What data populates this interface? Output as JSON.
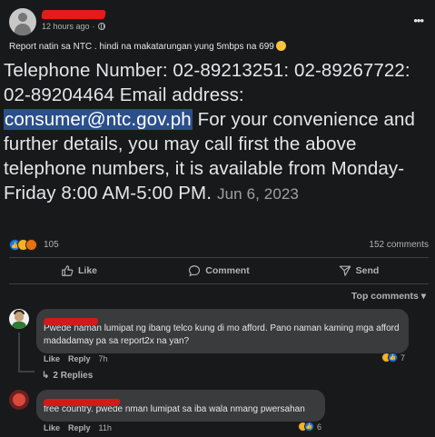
{
  "post": {
    "time": "12 hours ago",
    "dot": "·",
    "caption": "Report natin sa NTC . hindi na makatarungan yung 5mbps na 699",
    "menu_glyph": "•••"
  },
  "shared": {
    "line1": "Telephone Number: 02-89213251: 02-89267722:",
    "line2": "02-89204464 Email address:",
    "email": "consumer@ntc.gov.ph",
    "rest": " For your convenience and further details, you may call first the above telephone numbers, it is available from Monday-Friday 8:00 AM-5:00 PM.",
    "date": "Jun 6, 2023"
  },
  "stats": {
    "reactions": "105",
    "comments": "152 comments"
  },
  "actions": {
    "like": "Like",
    "comment": "Comment",
    "send": "Send"
  },
  "sort": {
    "label": "Top comments ▾"
  },
  "comments": [
    {
      "text": "Pwede naman lumipat ng ibang telco kung di mo afford. Pano naman kaming mga afford madadamay pa sa report2x na yan?",
      "like": "Like",
      "reply": "Reply",
      "time": "7h",
      "reaction_count": "7"
    },
    {
      "text": "free country. pwede nman lumipat sa iba wala nmang pwersahan",
      "like": "Like",
      "reply": "Reply",
      "time": "11h",
      "reaction_count": "6"
    }
  ],
  "replies": {
    "label": "2 Replies",
    "icon": "↳"
  },
  "colors": {
    "background": "#18191a",
    "bubble": "#3a3b3c",
    "email_highlight": "#2b4f8c",
    "like_blue": "#1877f2",
    "redaction": "#e21b1b"
  },
  "icons": [
    "globe-icon",
    "more-icon",
    "like-icon",
    "comment-icon",
    "send-icon",
    "reply-arrow-icon"
  ]
}
